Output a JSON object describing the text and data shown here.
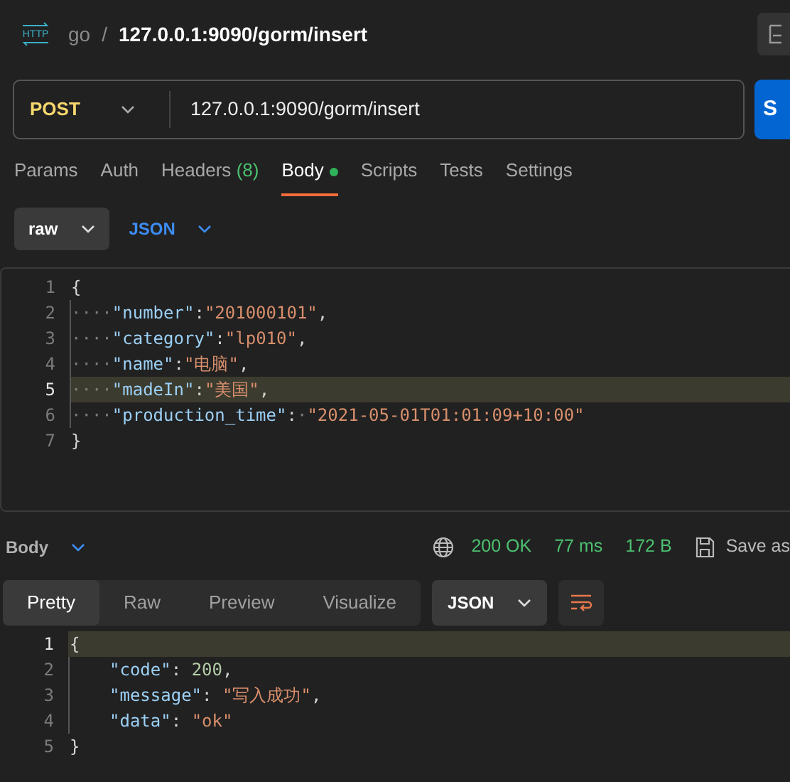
{
  "breadcrumb": {
    "icon_label": "HTTP",
    "parent": "go",
    "separator": "/",
    "current": "127.0.0.1:9090/gorm/insert"
  },
  "request": {
    "method": "POST",
    "url": "127.0.0.1:9090/gorm/insert",
    "send_label": "S"
  },
  "request_tabs": [
    {
      "label": "Params",
      "selected": false
    },
    {
      "label": "Auth",
      "selected": false
    },
    {
      "label": "Headers",
      "count": "(8)",
      "selected": false
    },
    {
      "label": "Body",
      "modified": true,
      "selected": true
    },
    {
      "label": "Scripts",
      "selected": false
    },
    {
      "label": "Tests",
      "selected": false
    },
    {
      "label": "Settings",
      "selected": false
    }
  ],
  "body_mode": {
    "type": "raw",
    "format": "JSON"
  },
  "request_body": {
    "lines": [
      {
        "number": "1",
        "highlighted": false,
        "tokens": [
          {
            "kind": "punct",
            "text": "{"
          }
        ]
      },
      {
        "number": "2",
        "highlighted": false,
        "tokens": [
          {
            "kind": "whitespace",
            "text": "····"
          },
          {
            "kind": "key",
            "text": "\"number\""
          },
          {
            "kind": "punct",
            "text": ":"
          },
          {
            "kind": "string",
            "text": "\"201000101\""
          },
          {
            "kind": "punct",
            "text": ","
          }
        ]
      },
      {
        "number": "3",
        "highlighted": false,
        "tokens": [
          {
            "kind": "whitespace",
            "text": "····"
          },
          {
            "kind": "key",
            "text": "\"category\""
          },
          {
            "kind": "punct",
            "text": ":"
          },
          {
            "kind": "string",
            "text": "\"lp010\""
          },
          {
            "kind": "punct",
            "text": ","
          }
        ]
      },
      {
        "number": "4",
        "highlighted": false,
        "tokens": [
          {
            "kind": "whitespace",
            "text": "····"
          },
          {
            "kind": "key",
            "text": "\"name\""
          },
          {
            "kind": "punct",
            "text": ":"
          },
          {
            "kind": "string",
            "text": "\"电脑\""
          },
          {
            "kind": "punct",
            "text": ","
          }
        ]
      },
      {
        "number": "5",
        "highlighted": true,
        "tokens": [
          {
            "kind": "whitespace",
            "text": "····"
          },
          {
            "kind": "key",
            "text": "\"madeIn\""
          },
          {
            "kind": "punct",
            "text": ":"
          },
          {
            "kind": "string",
            "text": "\"美国\""
          },
          {
            "kind": "punct",
            "text": ","
          }
        ]
      },
      {
        "number": "6",
        "highlighted": false,
        "tokens": [
          {
            "kind": "whitespace",
            "text": "····"
          },
          {
            "kind": "key",
            "text": "\"production_time\""
          },
          {
            "kind": "punct",
            "text": ":"
          },
          {
            "kind": "whitespace",
            "text": "·"
          },
          {
            "kind": "string",
            "text": "\"2021-05-01T01:01:09+10:00\""
          }
        ]
      },
      {
        "number": "7",
        "highlighted": false,
        "tokens": [
          {
            "kind": "punct",
            "text": "}"
          }
        ]
      }
    ]
  },
  "response": {
    "label": "Body",
    "status": "200 OK",
    "time": "77 ms",
    "size": "172 B",
    "save_label": "Save as"
  },
  "response_views": [
    {
      "label": "Pretty",
      "selected": true
    },
    {
      "label": "Raw",
      "selected": false
    },
    {
      "label": "Preview",
      "selected": false
    },
    {
      "label": "Visualize",
      "selected": false
    }
  ],
  "response_format": "JSON",
  "response_body": {
    "lines": [
      {
        "number": "1",
        "highlighted": true,
        "indented": false,
        "tokens": [
          {
            "kind": "punct",
            "text": "{"
          }
        ]
      },
      {
        "number": "2",
        "highlighted": false,
        "indented": true,
        "tokens": [
          {
            "kind": "key",
            "text": "\"code\""
          },
          {
            "kind": "punct",
            "text": ": "
          },
          {
            "kind": "number",
            "text": "200"
          },
          {
            "kind": "punct",
            "text": ","
          }
        ]
      },
      {
        "number": "3",
        "highlighted": false,
        "indented": true,
        "tokens": [
          {
            "kind": "key",
            "text": "\"message\""
          },
          {
            "kind": "punct",
            "text": ": "
          },
          {
            "kind": "string",
            "text": "\"写入成功\""
          },
          {
            "kind": "punct",
            "text": ","
          }
        ]
      },
      {
        "number": "4",
        "highlighted": false,
        "indented": true,
        "tokens": [
          {
            "kind": "key",
            "text": "\"data\""
          },
          {
            "kind": "punct",
            "text": ": "
          },
          {
            "kind": "string",
            "text": "\"ok\""
          }
        ]
      },
      {
        "number": "5",
        "highlighted": false,
        "indented": false,
        "tokens": [
          {
            "kind": "punct",
            "text": "}"
          }
        ]
      }
    ]
  }
}
